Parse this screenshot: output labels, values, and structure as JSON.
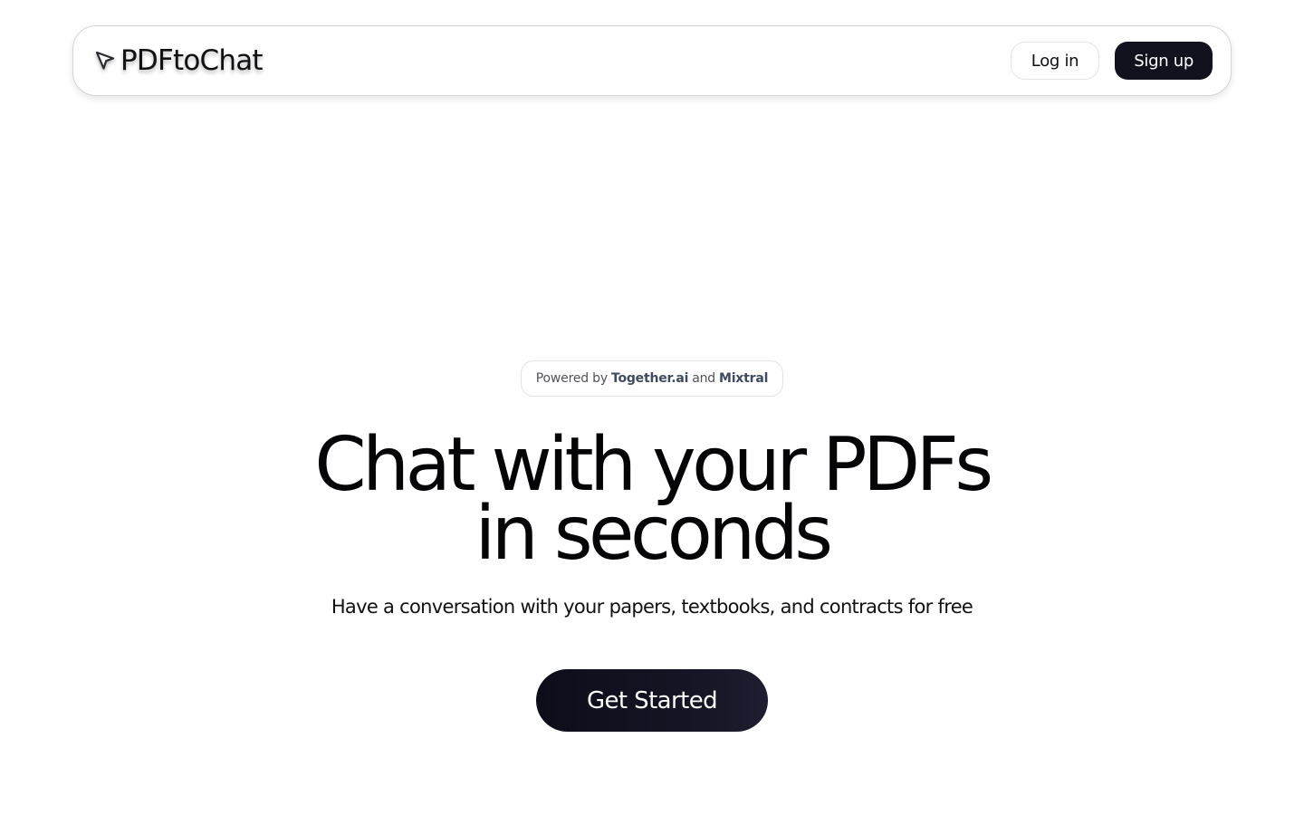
{
  "header": {
    "brand": "PDFtoChat",
    "brand_icon": "cursor-arrow-icon",
    "login_label": "Log in",
    "signup_label": "Sign up"
  },
  "hero": {
    "badge": {
      "prefix": "Powered by",
      "provider": "Together.ai",
      "connector": "and",
      "model": "Mixtral"
    },
    "headline_line1": "Chat with your PDFs",
    "headline_line2": "in seconds",
    "subtitle": "Have a conversation with your papers, textbooks, and contracts for free",
    "cta_label": "Get Started"
  },
  "colors": {
    "primary_dark": "#12121f",
    "border": "#e4e4e7",
    "badge_bold": "#3f4b5e"
  }
}
